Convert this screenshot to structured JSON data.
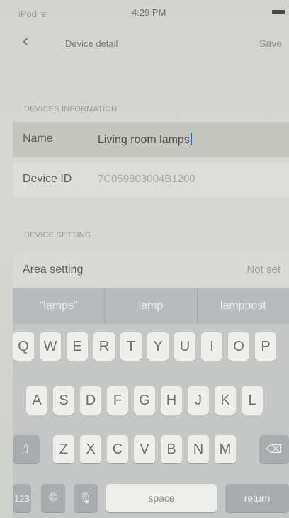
{
  "status_bar": {
    "carrier": "iPod ᯤ",
    "time": "4:29 PM"
  },
  "nav": {
    "back_icon": "chevron-left-icon",
    "title": "Device detail",
    "save_label": "Save"
  },
  "sections": {
    "devices_information": "DEVICES INFORMATION",
    "device_setting": "DEVICE SETTING"
  },
  "fields": {
    "name": {
      "label": "Name",
      "value": "Living room lamps"
    },
    "device_id": {
      "label": "Device ID",
      "value": "7C059803004B1200"
    },
    "area_setting": {
      "label": "Area setting",
      "value": "Not set"
    }
  },
  "suggestions": [
    "\"lamps\"",
    "lamp",
    "lamppost"
  ],
  "keyboard": {
    "row1": [
      "Q",
      "W",
      "E",
      "R",
      "T",
      "Y",
      "U",
      "I",
      "O",
      "P"
    ],
    "row2": [
      "A",
      "S",
      "D",
      "F",
      "G",
      "H",
      "J",
      "K",
      "L"
    ],
    "row3": [
      "Z",
      "X",
      "C",
      "V",
      "B",
      "N",
      "M"
    ],
    "numbers_label": "123",
    "space_label": "space",
    "return_label": "return"
  },
  "colors": {
    "caret": "#3a6fd0"
  }
}
